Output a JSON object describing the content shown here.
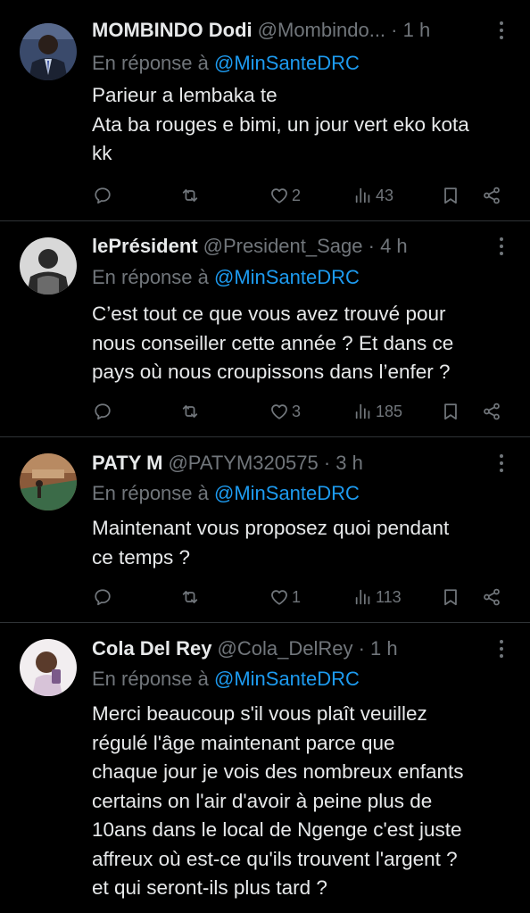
{
  "reply_prefix": "En réponse à ",
  "tweets": [
    {
      "name": "MOMBINDO Dodi",
      "handle": "@Mombindo...",
      "time": "1 h",
      "reply_to": "@MinSanteDRC",
      "lines": [
        "Parieur a lembaka te",
        "Ata ba rouges e bimi, un jour vert eko kota",
        "kk"
      ],
      "likes": "2",
      "views": "43",
      "avatar": {
        "bg": "#3a4a6b",
        "fg": "#1b2232",
        "accent": "#c8d3e6"
      }
    },
    {
      "name": "lePrésident",
      "handle": "@President_Sage",
      "time": "4 h",
      "reply_to": "@MinSanteDRC",
      "lines": [
        "C’est tout ce que vous avez trouvé pour",
        "nous conseiller cette année ? Et dans ce",
        "pays où nous croupissons dans l’enfer ?"
      ],
      "likes": "3",
      "views": "185",
      "avatar": {
        "bg": "#d8d8d8",
        "fg": "#2a2a2a",
        "accent": "#6b6b6b"
      }
    },
    {
      "name": "PATY M",
      "handle": "@PATYM320575",
      "time": "3 h",
      "reply_to": "@MinSanteDRC",
      "lines": [
        "Maintenant vous proposez quoi pendant",
        "ce temps ?"
      ],
      "likes": "1",
      "views": "113",
      "avatar": {
        "bg": "#8a5a3a",
        "fg": "#3b6b48",
        "accent": "#c9a27a"
      }
    },
    {
      "name": "Cola Del Rey",
      "handle": "@Cola_DelRey",
      "time": "1 h",
      "reply_to": "@MinSanteDRC",
      "lines": [
        "Merci beaucoup s'il vous plaît veuillez",
        "régulé l'âge maintenant parce que",
        "chaque jour je vois des nombreux enfants",
        "certains on l'air d'avoir à peine plus de",
        "10ans dans le local de Ngenge c'est juste",
        "affreux où est-ce qu'ils trouvent l'argent ?",
        "et qui seront-ils plus tard ?"
      ],
      "likes": "",
      "views": "",
      "avatar": {
        "bg": "#f2eef0",
        "fg": "#5a3b2b",
        "accent": "#d7c3d8"
      }
    }
  ]
}
